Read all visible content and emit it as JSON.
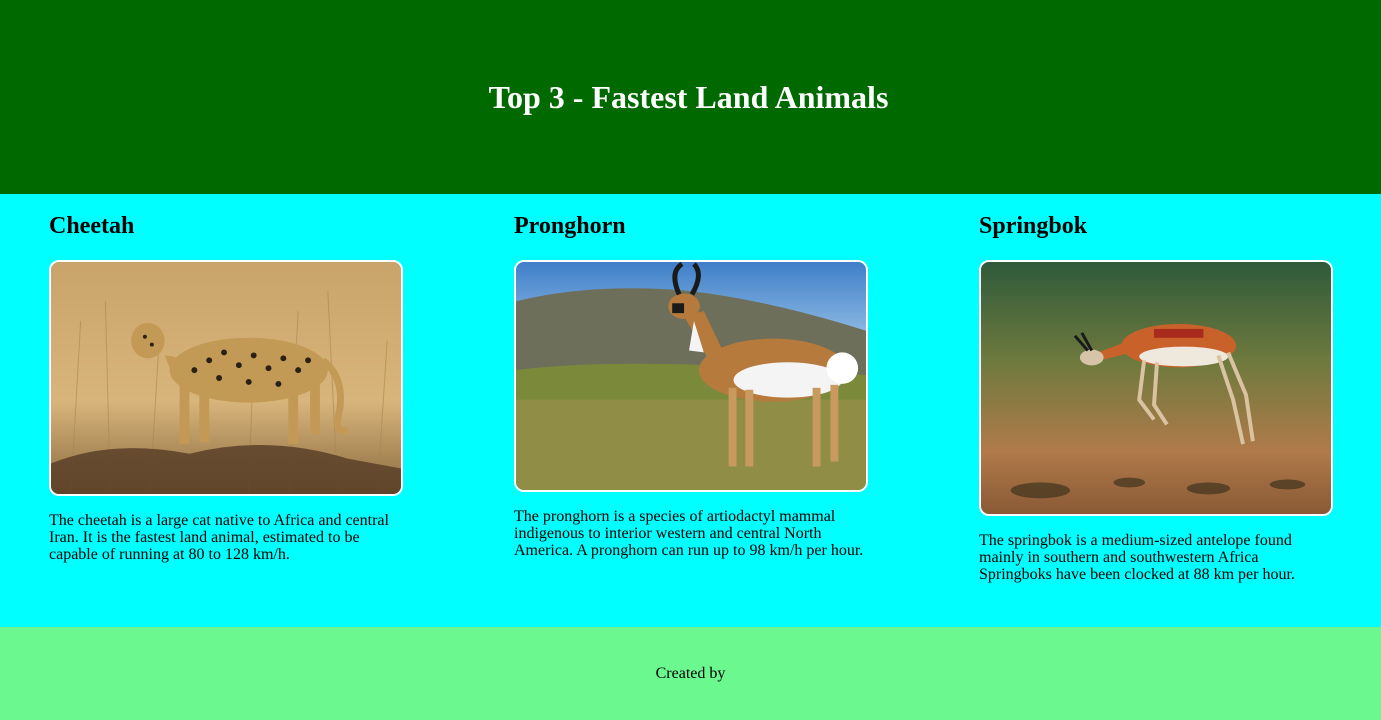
{
  "header": {
    "title": "Top 3 - Fastest Land Animals"
  },
  "animals": [
    {
      "name": "Cheetah",
      "image_alt": "cheetah photo",
      "description": "The cheetah is a large cat native to Africa and central Iran. It is the fastest land animal, estimated to be capable of running at 80 to 128 km/h."
    },
    {
      "name": "Pronghorn",
      "image_alt": "pronghorn photo",
      "description": "The pronghorn is a species of artiodactyl mammal indigenous to interior western and central North America. A pronghorn can run up to 98 km/h per hour."
    },
    {
      "name": "Springbok",
      "image_alt": "springbok photo",
      "description": "The springbok is a medium-sized antelope found mainly in southern and southwestern Africa Springboks have been clocked at 88 km per hour."
    }
  ],
  "footer": {
    "text": "Created by"
  },
  "colors": {
    "header_bg": "#006a00",
    "main_bg": "#00ffff",
    "footer_bg": "#6bf98f"
  }
}
